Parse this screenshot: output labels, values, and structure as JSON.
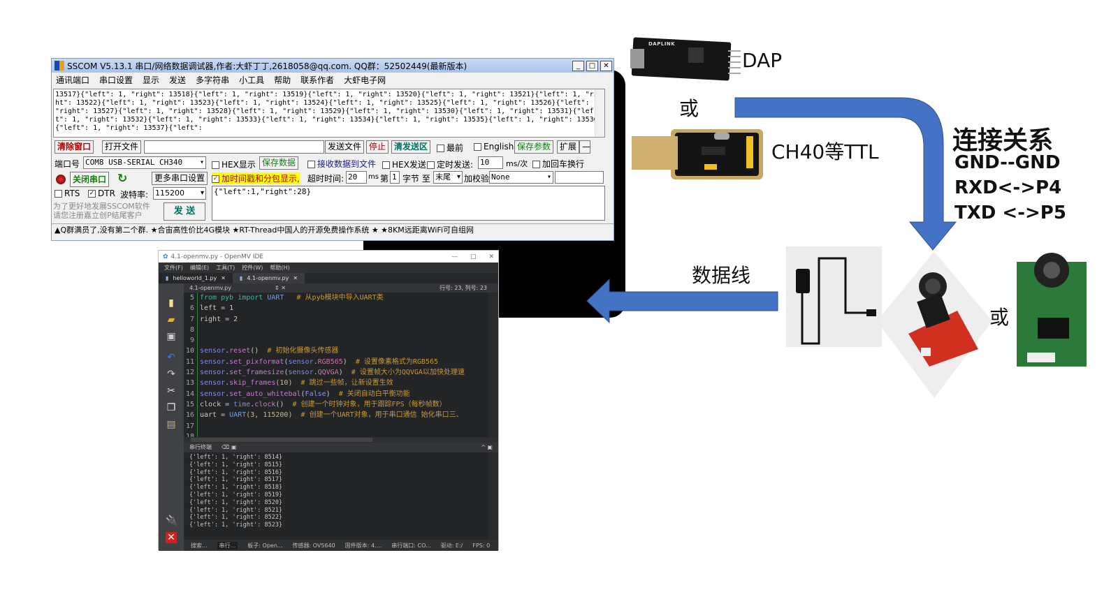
{
  "sscom": {
    "title": "SSCOM V5.13.1 串口/网络数据调试器,作者:大虾丁丁,2618058@qq.com. QQ群：52502449(最新版本)",
    "menu": [
      "通讯端口",
      "串口设置",
      "显示",
      "发送",
      "多字符串",
      "小工具",
      "帮助",
      "联系作者",
      "大虾电子网"
    ],
    "receive_text": "13517}{\"left\": 1, \"right\": 13518}{\"left\": 1, \"right\": 13519}{\"left\": 1, \"right\": 13520}{\"left\": 1, \"right\": 13521}{\"left\": 1, \"right\": 13522}{\"left\": 1, \"right\": 13523}{\"left\": 1, \"right\": 13524}{\"left\": 1, \"right\": 13525}{\"left\": 1, \"right\": 13526}{\"left\": 1, \"right\": 13527}{\"left\": 1, \"right\": 13528}{\"left\": 1, \"right\": 13529}{\"left\": 1, \"right\": 13530}{\"left\": 1, \"right\": 13531}{\"left\": 1, \"right\": 13532}{\"left\": 1, \"right\": 13533}{\"left\": 1, \"right\": 13534}{\"left\": 1, \"right\": 13535}{\"left\": 1, \"right\": 13536}{\"left\": 1, \"right\": 13537}{\"left\":",
    "clear_window": "清除窗口",
    "open_file": "打开文件",
    "file_path": "",
    "send_file": "发送文件",
    "stop": "停止",
    "clear_send": "清发送区",
    "topmost": "最前",
    "english": "English",
    "save_params": "保存参数",
    "expand": "扩展",
    "collapse": "—",
    "port_label": "端口号",
    "port_value": "COM8 USB-SERIAL CH340",
    "hex_display": "HEX显示",
    "save_data": "保存数据",
    "recv_to_file": "接收数据到文件",
    "hex_send": "HEX发送",
    "timed_send": "定时发送:",
    "interval": "10",
    "interval_unit": "ms/次",
    "add_crlf": "加回车换行",
    "close_port": "关闭串口",
    "more_settings": "更多串口设置",
    "timestamp": "加时间戳和分包显示,",
    "timeout_label": "超时时间:",
    "timeout": "20",
    "timeout_unit": "ms",
    "byte_from_label": "第",
    "byte_from": "1",
    "byte_label": "字节 至",
    "byte_to": "末尾",
    "checksum_label": "加校验",
    "checksum": "None",
    "rts": "RTS",
    "dtr": "DTR",
    "baud_label": "波特率:",
    "baud": "115200",
    "send_text": "{\"left\":1,\"right\":28}",
    "promo": "为了更好地发展SSCOM软件\n请您注册嘉立创P结尾客户",
    "send": "发 送",
    "status": "▲Q群满员了,没有第二个群. ★合宙高性价比4G模块 ★RT-Thread中国人的开源免费操作系统 ★ ★8KM远距离WiFi可自组网"
  },
  "openmv": {
    "title": "4.1-openmv.py - OpenMV IDE",
    "menu": [
      "文件(F)",
      "编辑(E)",
      "工具(T)",
      "控件(W)",
      "帮助(H)"
    ],
    "tabs": [
      {
        "label": "helloworld_1.py"
      },
      {
        "label": "4.1-openmv.py",
        "active": true
      }
    ],
    "editor_file": "4.1-openmv.py",
    "cursor": "行号: 23, 列号: 23",
    "code": [
      {
        "n": "5",
        "tokens": [
          [
            "from ",
            "kw"
          ],
          [
            "pyb ",
            "kw"
          ],
          [
            "import ",
            "kw"
          ],
          [
            "UART",
            "cls"
          ],
          [
            "   # 从pyb模块中导入UART类",
            "cm"
          ]
        ]
      },
      {
        "n": "6",
        "tokens": [
          [
            "left = 1",
            "def"
          ]
        ]
      },
      {
        "n": "7",
        "tokens": [
          [
            "right = 2",
            "def"
          ]
        ]
      },
      {
        "n": "8",
        "tokens": []
      },
      {
        "n": "9",
        "tokens": []
      },
      {
        "n": "10",
        "tokens": [
          [
            "sensor",
            "obj"
          ],
          [
            ".",
            "def"
          ],
          [
            "reset",
            "fn"
          ],
          [
            "()",
            "def"
          ],
          [
            "  # 初始化摄像头传感器",
            "cm"
          ]
        ]
      },
      {
        "n": "11",
        "tokens": [
          [
            "sensor",
            "obj"
          ],
          [
            ".",
            "def"
          ],
          [
            "set_pixformat",
            "fn"
          ],
          [
            "(",
            "def"
          ],
          [
            "sensor",
            "obj"
          ],
          [
            ".",
            "def"
          ],
          [
            "RGB565",
            "arg"
          ],
          [
            ")",
            "def"
          ],
          [
            "  # 设置像素格式为RGB565",
            "cm"
          ]
        ]
      },
      {
        "n": "12",
        "tokens": [
          [
            "sensor",
            "obj"
          ],
          [
            ".",
            "def"
          ],
          [
            "set_framesize",
            "fn"
          ],
          [
            "(",
            "def"
          ],
          [
            "sensor",
            "obj"
          ],
          [
            ".",
            "def"
          ],
          [
            "QQVGA",
            "arg"
          ],
          [
            ")",
            "def"
          ],
          [
            "  # 设置帧大小为QQVGA以加快处理速",
            "cm"
          ]
        ]
      },
      {
        "n": "13",
        "tokens": [
          [
            "sensor",
            "obj"
          ],
          [
            ".",
            "def"
          ],
          [
            "skip_frames",
            "fn"
          ],
          [
            "(10)",
            "num"
          ],
          [
            "  # 跳过一些帧，让新设置生效",
            "cm"
          ]
        ]
      },
      {
        "n": "14",
        "tokens": [
          [
            "sensor",
            "obj"
          ],
          [
            ".",
            "def"
          ],
          [
            "set_auto_whitebal",
            "fn"
          ],
          [
            "(",
            "def"
          ],
          [
            "False",
            "bool"
          ],
          [
            ")",
            "def"
          ],
          [
            "  # 关闭自动白平衡功能",
            "cm"
          ]
        ]
      },
      {
        "n": "15",
        "tokens": [
          [
            "clock = ",
            "def"
          ],
          [
            "time",
            "obj"
          ],
          [
            ".",
            "def"
          ],
          [
            "clock",
            "fn"
          ],
          [
            "()",
            "def"
          ],
          [
            "  # 创建一个时钟对象，用于跟踪FPS（每秒帧数）",
            "cm"
          ]
        ]
      },
      {
        "n": "16",
        "tokens": [
          [
            "uart = ",
            "def"
          ],
          [
            "UART",
            "cls"
          ],
          [
            "(3, 115200)",
            "num"
          ],
          [
            "  # 创建一个UART对象，用于串口通信 始化串口三、",
            "cm"
          ]
        ]
      },
      {
        "n": "17",
        "tokens": []
      },
      {
        "n": "18",
        "tokens": []
      }
    ],
    "terminal_title": "串行终端",
    "terminal": [
      "{'left': 1, 'right': 8514}",
      "{'left': 1, 'right': 8515}",
      "{'left': 1, 'right': 8516}",
      "{'left': 1, 'right': 8517}",
      "{'left': 1, 'right': 8518}",
      "{'left': 1, 'right': 8519}",
      "{'left': 1, 'right': 8520}",
      "{'left': 1, 'right': 8521}",
      "{'left': 1, 'right': 8522}",
      "{'left': 1, 'right': 8523}"
    ],
    "status": [
      "搜索...",
      "串行...",
      "板子: Open...",
      "传感器: OV5640",
      "固件版本: 4....",
      "串行端口: CO...",
      "驱动: E:/",
      "FPS: 0"
    ]
  },
  "diagram": {
    "dap": "DAP",
    "or1": "或",
    "ch340": "CH40等TTL",
    "title": "连接关系",
    "connections": [
      "GND--GND",
      "RXD<->P4",
      "TXD <->P5"
    ],
    "cable": "数据线",
    "or2": "或",
    "arrow_color": "#4472c4",
    "dap_board_label": "DAPLINK"
  }
}
